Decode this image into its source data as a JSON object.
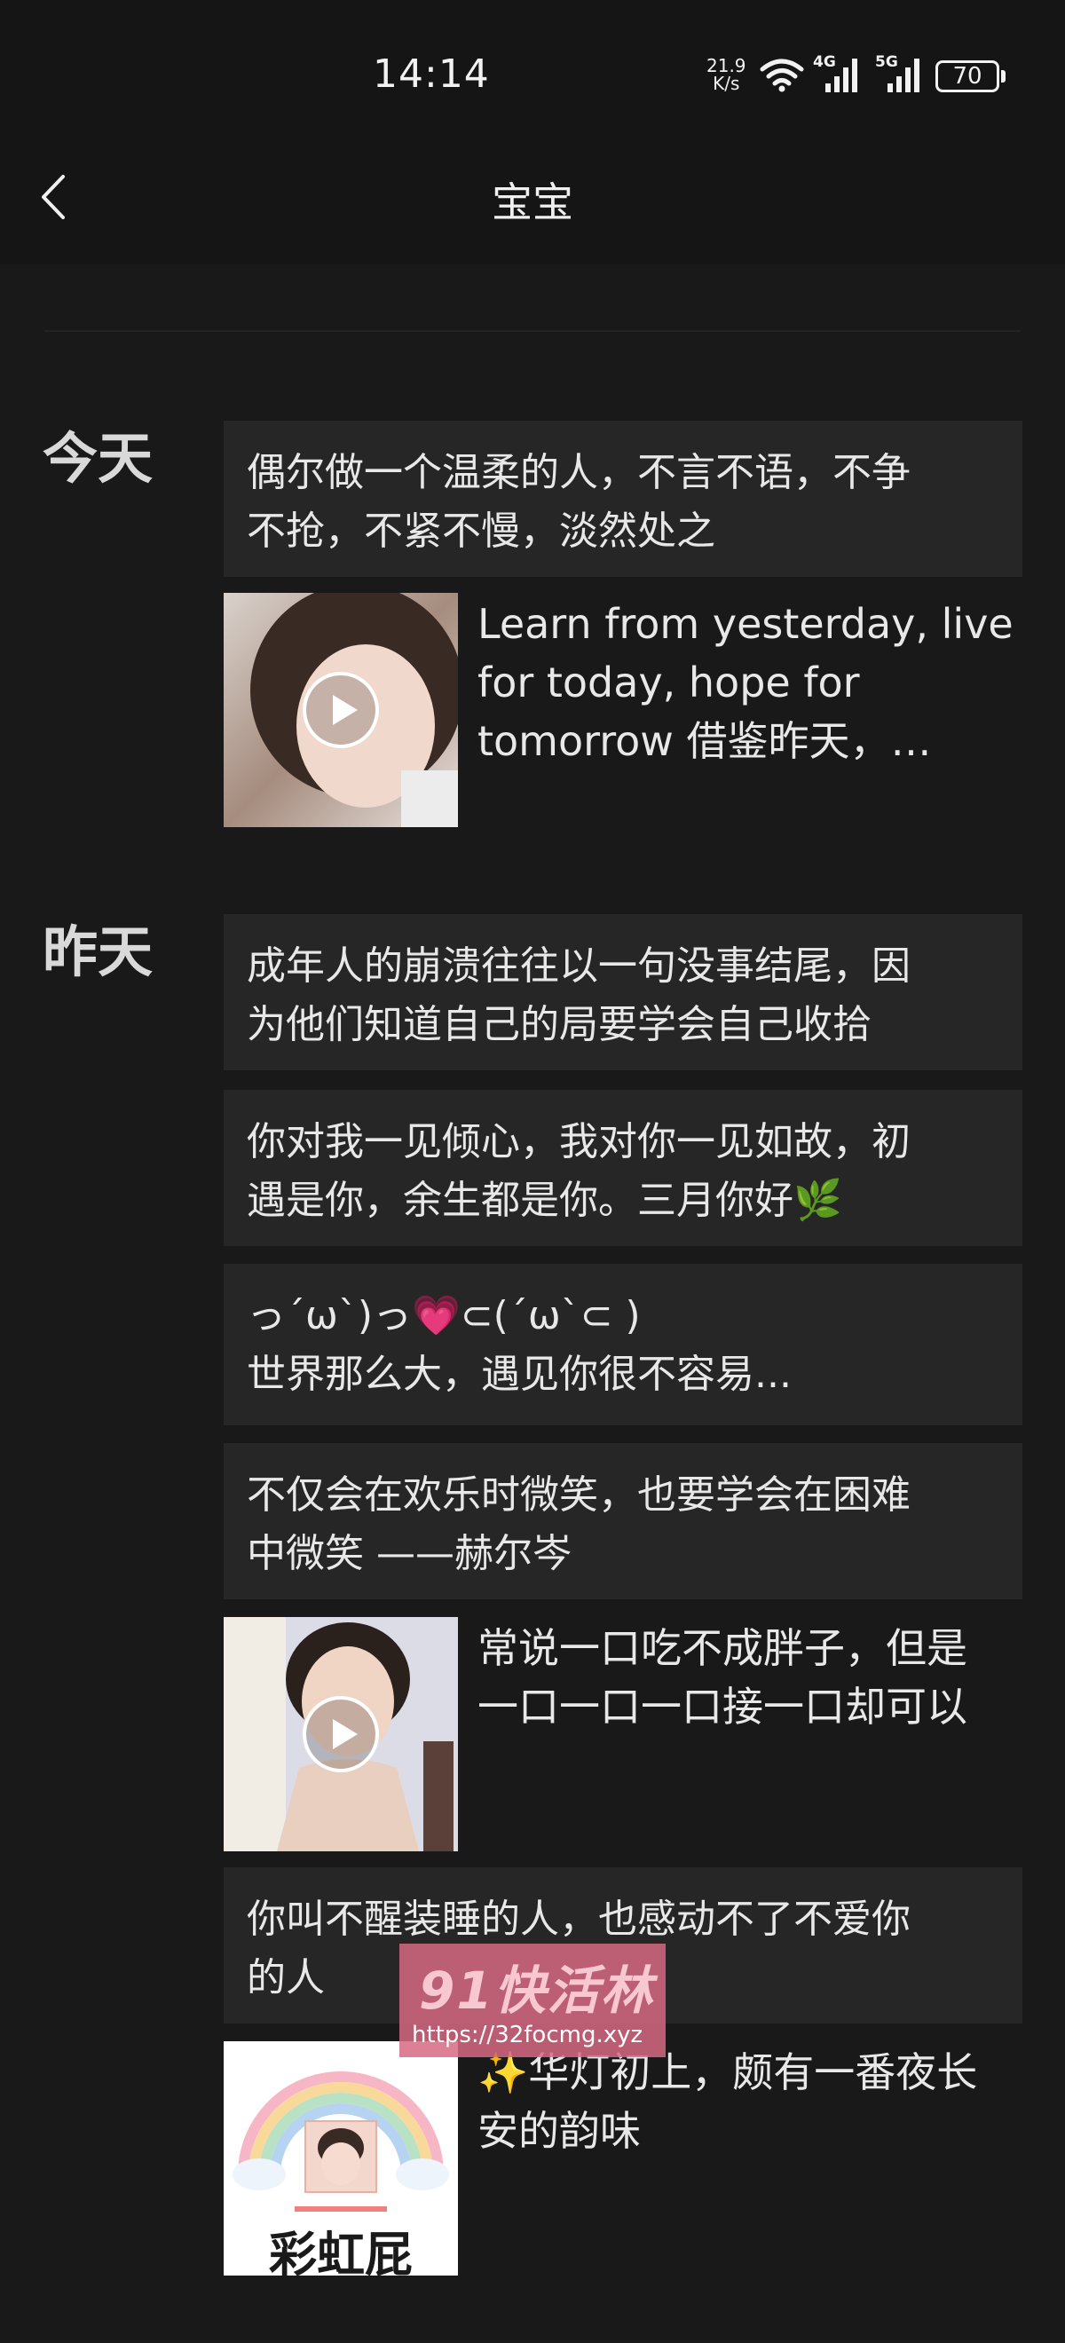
{
  "status_bar": {
    "time": "14:14",
    "net_speed_value": "21.9",
    "net_speed_unit": "K/s",
    "signal_1_label": "4G",
    "signal_2_label": "5G",
    "battery_level": "70"
  },
  "header": {
    "title": "宝宝",
    "back_icon": "chevron-left-icon"
  },
  "sections": [
    {
      "label": "今天",
      "items": [
        {
          "type": "text",
          "text": "偶尔做一个温柔的人，不言不语，不争\n不抢，不紧不慢，淡然处之"
        },
        {
          "type": "video",
          "caption": "Learn from yesterday, live\nfor today, hope for\ntomorrow 借鉴昨天，…"
        }
      ]
    },
    {
      "label": "昨天",
      "items": [
        {
          "type": "text",
          "text": "成年人的崩溃往往以一句没事结尾，因\n为他们知道自己的局要学会自己收拾"
        },
        {
          "type": "text",
          "text": "你对我一见倾心，我对你一见如故，初\n遇是你，余生都是你。三月你好🌿"
        },
        {
          "type": "text",
          "text": "っ´ω`)っ💗⊂(´ω`⊂ )\n世界那么大，遇见你很不容易..."
        },
        {
          "type": "text",
          "text": "不仅会在欢乐时微笑，也要学会在困难\n中微笑 ——赫尔岑"
        },
        {
          "type": "video",
          "caption": "常说一口吃不成胖子，但是\n一口一口一口接一口却可以"
        },
        {
          "type": "text",
          "text": "你叫不醒装睡的人，也感动不了不爱你\n的人"
        },
        {
          "type": "image",
          "caption": "✨华灯初上，颇有一番夜长\n安的韵味",
          "image_text": "彩虹屁"
        }
      ]
    }
  ],
  "watermark": {
    "brand": "91快活林",
    "url": "https://32focmg.xyz"
  },
  "colors": {
    "background": "#191919",
    "card": "#262626",
    "header": "#151515",
    "watermark": "#d86a82"
  }
}
